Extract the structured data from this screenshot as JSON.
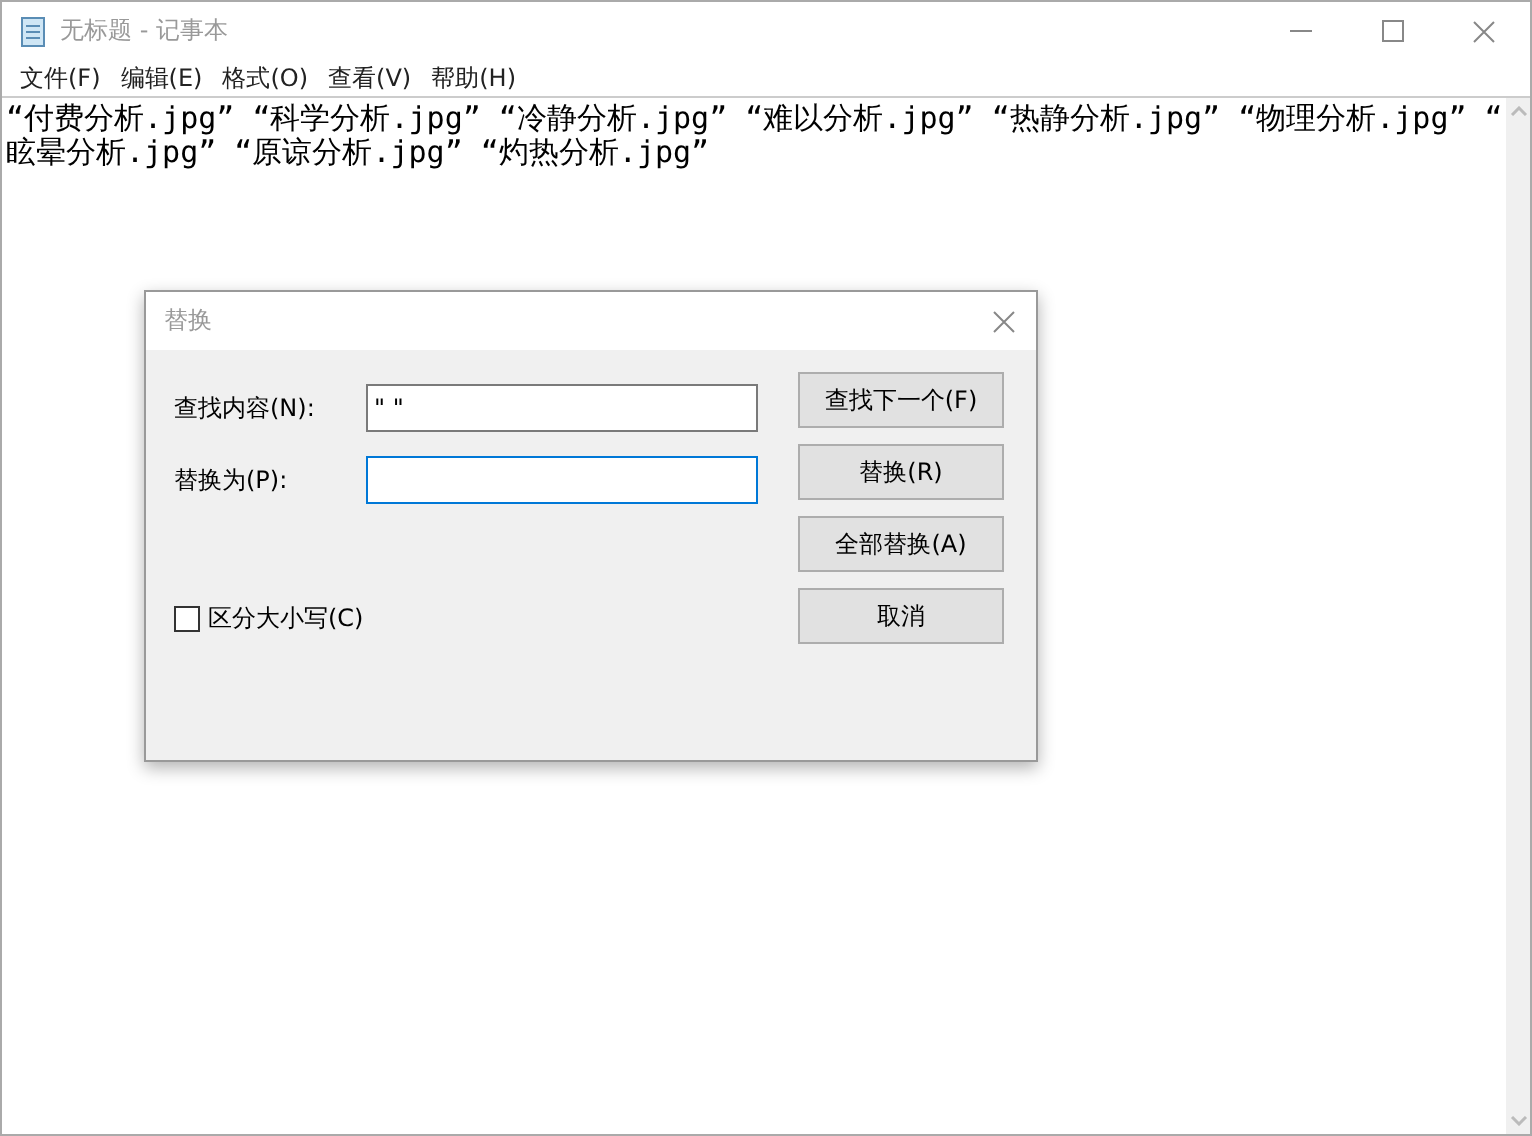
{
  "window": {
    "title": "无标题 - 记事本"
  },
  "menu": [
    "文件(F)",
    "编辑(E)",
    "格式(O)",
    "查看(V)",
    "帮助(H)"
  ],
  "editor": {
    "lines": [
      "“付费分析.jpg” “科学分析.jpg” “冷静分析.jpg” “难以分析.jpg” “热静分析.jpg” “物理分析.jpg” “",
      "眩晕分析.jpg” “原谅分析.jpg” “灼热分析.jpg”"
    ]
  },
  "dialog": {
    "title": "替换",
    "fields": [
      {
        "label": "查找内容(N):",
        "value": "\" \"",
        "focused": false
      },
      {
        "label": "替换为(P):",
        "focused": true
      }
    ],
    "buttons": [
      "查找下一个(F)",
      "替换(R)",
      "全部替换(A)",
      "取消"
    ],
    "match_case": {
      "label": "区分大小写(C)",
      "checked": false
    }
  }
}
